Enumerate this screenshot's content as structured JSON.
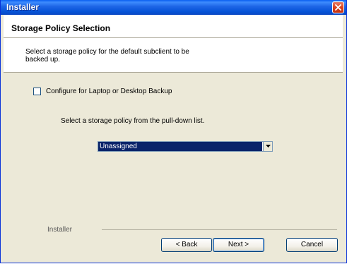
{
  "window": {
    "title": "Installer"
  },
  "header": {
    "title": "Storage Policy Selection",
    "description": "Select a storage policy for the default subclient to be backed up."
  },
  "options": {
    "laptop_checkbox_label": "Configure for Laptop or Desktop Backup",
    "laptop_checkbox_checked": false
  },
  "policy": {
    "instruction": "Select a storage policy from the pull-down list.",
    "selected_value": "Unassigned"
  },
  "footer": {
    "brand_label": "Installer",
    "back_label": "< Back",
    "next_label": "Next >",
    "cancel_label": "Cancel"
  },
  "icons": {
    "close": "close-icon",
    "dropdown": "chevron-down-icon"
  },
  "colors": {
    "titlebar": "#0a5ff0",
    "dialog_background": "#ece9d8",
    "selection": "#0a246a",
    "close_button": "#d9421e"
  }
}
